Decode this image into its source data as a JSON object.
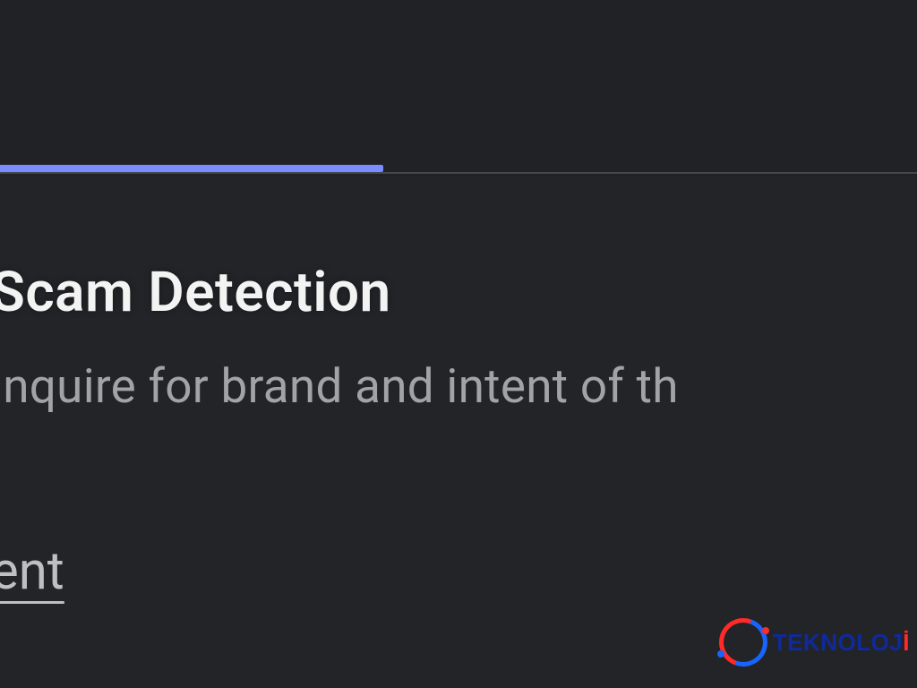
{
  "section": {
    "heading": " Scam Detection",
    "description": "inquire for brand and intent of th",
    "link_fragment": "ent"
  },
  "watermark": {
    "brand_text": "TEKNOLOJ",
    "brand_last_char": "İ"
  },
  "colors": {
    "bg_top": "#202226",
    "bg_content": "#232428",
    "tab_active": "#7a8cff",
    "tab_baseline": "#4c4f55",
    "heading_text": "#f3f3f4",
    "body_text": "#a1a3a7",
    "link_text": "#bdbfc3",
    "brand_blue": "#1765ff",
    "brand_red": "#ff2a2a"
  }
}
